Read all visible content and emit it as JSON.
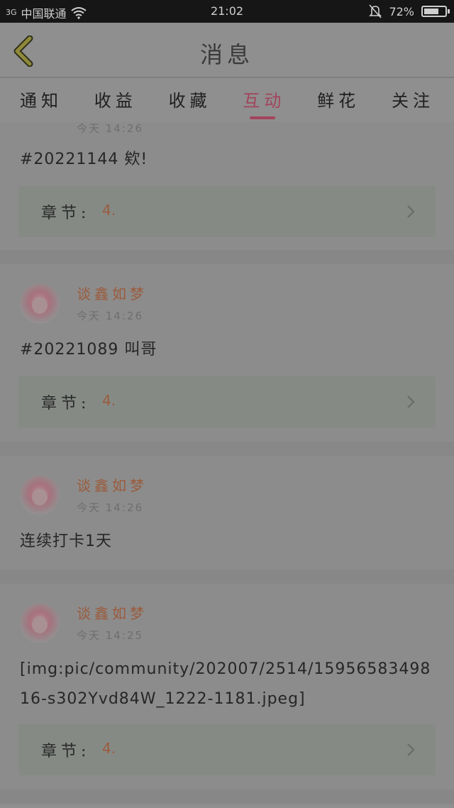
{
  "status_bar": {
    "network": "3G",
    "carrier": "中国联通",
    "time": "21:02",
    "battery": "72%",
    "battery_level": 0.72
  },
  "header": {
    "title": "消息"
  },
  "tabs": [
    {
      "label": "通知",
      "active": false
    },
    {
      "label": "收益",
      "active": false
    },
    {
      "label": "收藏",
      "active": false
    },
    {
      "label": "互动",
      "active": true
    },
    {
      "label": "鲜花",
      "active": false
    },
    {
      "label": "关注",
      "active": false
    }
  ],
  "posts": [
    {
      "author": "",
      "time": "今天 14:26",
      "content": "#20221144 欸!",
      "chapter_label": "章节:",
      "chapter_value": "4."
    },
    {
      "author": "谈鑫如梦",
      "time": "今天 14:26",
      "content": "#20221089 叫哥",
      "chapter_label": "章节:",
      "chapter_value": "4."
    },
    {
      "author": "谈鑫如梦",
      "time": "今天 14:26",
      "content": "连续打卡1天"
    },
    {
      "author": "谈鑫如梦",
      "time": "今天 14:25",
      "content": "[img:pic/community/202007/2514/1595658349816-s302Yvd84W_1222-1181.jpeg]",
      "chapter_label": "章节:",
      "chapter_value": "4."
    }
  ]
}
